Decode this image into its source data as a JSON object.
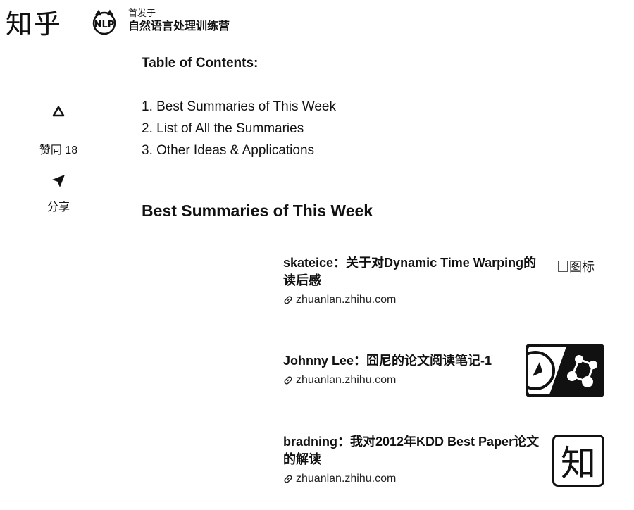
{
  "header": {
    "logo_text": "知乎",
    "avatar_icon": "column-avatar-icon",
    "published_prefix": "首发于",
    "column_name": "自然语言处理训练营"
  },
  "sidebar": {
    "vote_icon": "upvote-triangle-icon",
    "vote_label": "赞同 18",
    "share_icon": "share-paper-plane-icon",
    "share_label": "分享"
  },
  "article": {
    "toc_title": "Table of Contents:",
    "toc_items": [
      "1. Best Summaries of This Week",
      "2. List of All the Summaries",
      "3. Other Ideas & Applications"
    ],
    "section_heading": "Best Summaries of This Week",
    "cards": [
      {
        "title": "skateice：关于对Dynamic Time Warping的读后感",
        "link": "zhuanlan.zhihu.com",
        "thumb_alt": "图标"
      },
      {
        "title": "Johnny Lee：囧尼的论文阅读笔记-1",
        "link": "zhuanlan.zhihu.com",
        "thumb_icon": "rocket-network-thumbnail-icon"
      },
      {
        "title": "bradning：我对2012年KDD Best Paper论文的解读",
        "link": "zhuanlan.zhihu.com",
        "thumb_text": "知"
      }
    ]
  }
}
